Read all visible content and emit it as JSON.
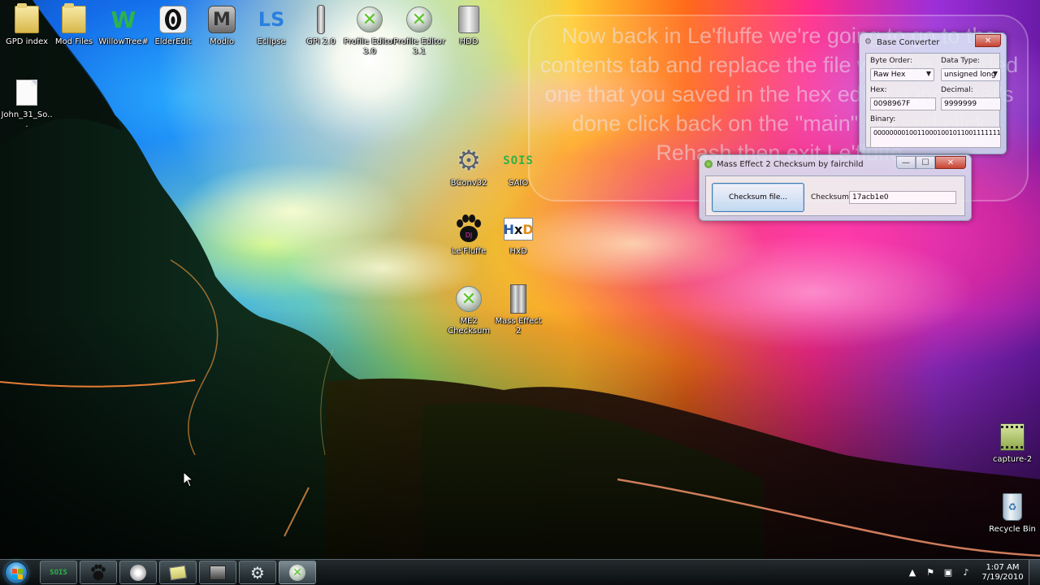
{
  "desktop": {
    "icons": [
      {
        "label": "GPD index",
        "icon": "folder-icon"
      },
      {
        "label": "Mod Files",
        "icon": "folder-icon"
      },
      {
        "label": "WillowTree#",
        "icon": "willowtree-icon"
      },
      {
        "label": "ElderEdit",
        "icon": "elderedit-icon"
      },
      {
        "label": "Modio",
        "icon": "modio-icon"
      },
      {
        "label": "Eclipse",
        "icon": "eclipse-icon"
      },
      {
        "label": "GPI 2.0",
        "icon": "gpi-icon"
      },
      {
        "label": "Profile Editor 3.0",
        "icon": "xbox-icon"
      },
      {
        "label": "Profile Editor 3.1",
        "icon": "xbox-icon"
      },
      {
        "label": "HDD",
        "icon": "hdd-icon"
      },
      {
        "label": "John_31_So...",
        "icon": "document-icon"
      },
      {
        "label": "BConv32",
        "icon": "gear-icon"
      },
      {
        "label": "SAIO",
        "icon": "saio-icon"
      },
      {
        "label": "Le'Fluffe",
        "icon": "paw-icon"
      },
      {
        "label": "HxD",
        "icon": "hxd-icon"
      },
      {
        "label": "ME2 Checksum",
        "icon": "xbox-icon"
      },
      {
        "label": "Mass Effect 2",
        "icon": "archive-icon"
      },
      {
        "label": "capture-2",
        "icon": "video-file-icon"
      },
      {
        "label": "Recycle Bin",
        "icon": "recycle-bin-icon"
      }
    ]
  },
  "caption": "Now back in Le'fluffe we're going to go to the contents tab and replace the file with the modded one that you saved in the hex editor. Once that's done click back on the \"main\" tab and click Rehash then exit Le'fluffe",
  "base_converter": {
    "title": "Base Converter",
    "byte_order_label": "Byte Order:",
    "byte_order_value": "Raw Hex",
    "data_type_label": "Data Type:",
    "data_type_value": "unsigned long",
    "hex_label": "Hex:",
    "hex_value": "0098967F",
    "decimal_label": "Decimal:",
    "decimal_value": "9999999",
    "binary_label": "Binary:",
    "binary_value": "00000000100110001001011001111111",
    "close_glyph": "✕"
  },
  "checksum_window": {
    "title": "Mass Effect 2 Checksum by fairchild",
    "button_label": "Checksum file...",
    "checksum_label": "Checksum",
    "checksum_value": "17acb1e0",
    "min_glyph": "—",
    "max_glyph": "☐",
    "close_glyph": "✕"
  },
  "taskbar": {
    "clock_time": "1:07 AM",
    "clock_date": "7/19/2010",
    "buttons": [
      {
        "icon": "saio-icon"
      },
      {
        "icon": "paw-icon"
      },
      {
        "icon": "hdd-icon"
      },
      {
        "icon": "notes-icon"
      },
      {
        "icon": "film-icon"
      },
      {
        "icon": "gear-icon"
      },
      {
        "icon": "xbox-icon"
      }
    ],
    "tray_icons": [
      "up-arrow-icon",
      "flag-icon",
      "network-icon",
      "volume-icon"
    ]
  },
  "colors": {
    "xbox_green": "#5ec42a",
    "taskbar": "#14191c",
    "caption_text": "#ebebf5"
  }
}
